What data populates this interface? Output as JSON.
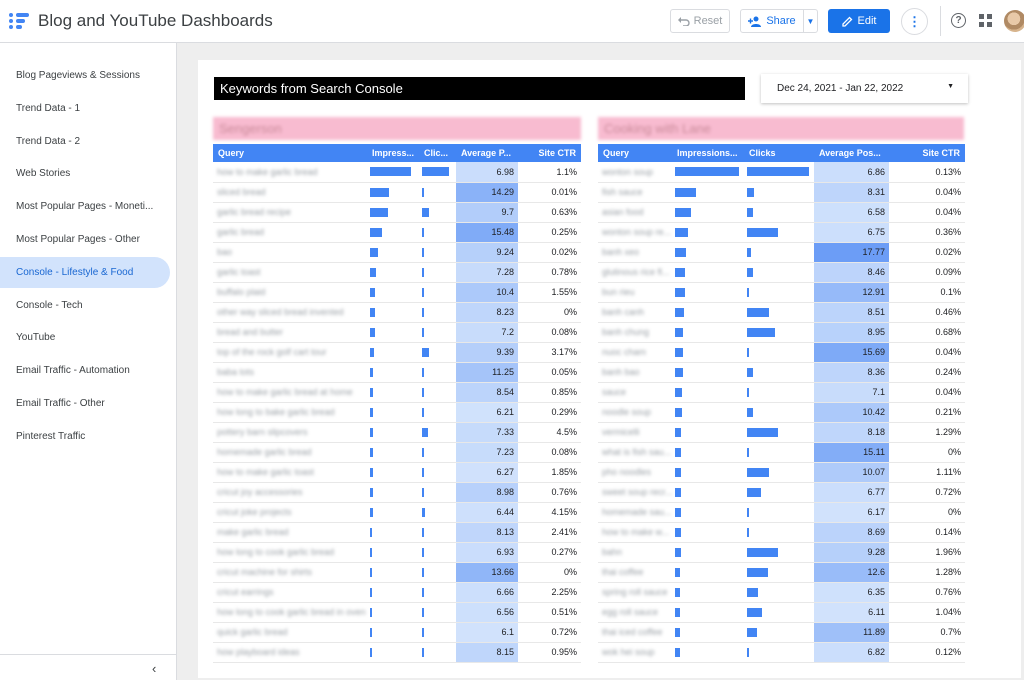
{
  "app": {
    "title": "Blog and YouTube Dashboards"
  },
  "toolbar": {
    "reset_label": "Reset",
    "share_label": "Share",
    "edit_label": "Edit"
  },
  "sidebar": {
    "items": [
      {
        "label": "Blog Pageviews & Sessions",
        "active": false
      },
      {
        "label": "Trend Data - 1",
        "active": false
      },
      {
        "label": "Trend Data - 2",
        "active": false
      },
      {
        "label": "Web Stories",
        "active": false
      },
      {
        "label": "Most Popular Pages - Moneti...",
        "active": false
      },
      {
        "label": "Most Popular Pages - Other",
        "active": false
      },
      {
        "label": "Console - Lifestyle & Food",
        "active": true
      },
      {
        "label": "Console - Tech",
        "active": false
      },
      {
        "label": "YouTube",
        "active": false
      },
      {
        "label": "Email Traffic - Automation",
        "active": false
      },
      {
        "label": "Email Traffic - Other",
        "active": false
      },
      {
        "label": "Pinterest Traffic",
        "active": false
      }
    ]
  },
  "report": {
    "title": "Keywords from Search Console",
    "date_range": "Dec 24, 2021 - Jan 22, 2022"
  },
  "colors": {
    "accent": "#1a73e8",
    "header_blue": "#4285f4",
    "site_title_pink": "#f8bbd0"
  },
  "tables": [
    {
      "site_title": "Sengerson",
      "columns": [
        "Query",
        "Impress...",
        "Clic...",
        "Average P...",
        "Site CTR"
      ],
      "rows": [
        {
          "query": "how to make garlic bread",
          "impressions": 0.97,
          "clicks": 1.0,
          "avg_pos": "6.98",
          "ctr": "1.1%"
        },
        {
          "query": "sliced bread",
          "impressions": 0.45,
          "clicks": 0.03,
          "avg_pos": "14.29",
          "ctr": "0.01%"
        },
        {
          "query": "garlic bread recipe",
          "impressions": 0.42,
          "clicks": 0.25,
          "avg_pos": "9.7",
          "ctr": "0.63%"
        },
        {
          "query": "garlic bread",
          "impressions": 0.28,
          "clicks": 0.03,
          "avg_pos": "15.48",
          "ctr": "0.25%"
        },
        {
          "query": "bao",
          "impressions": 0.19,
          "clicks": 0.02,
          "avg_pos": "9.24",
          "ctr": "0.02%"
        },
        {
          "query": "garlic toast",
          "impressions": 0.14,
          "clicks": 0.05,
          "avg_pos": "7.28",
          "ctr": "0.78%"
        },
        {
          "query": "buffalo plaid",
          "impressions": 0.13,
          "clicks": 0.09,
          "avg_pos": "10.4",
          "ctr": "1.55%"
        },
        {
          "query": "other way sliced bread invented",
          "impressions": 0.12,
          "clicks": 0.0,
          "avg_pos": "8.23",
          "ctr": "0%"
        },
        {
          "query": "bread and butter",
          "impressions": 0.11,
          "clicks": 0.03,
          "avg_pos": "7.2",
          "ctr": "0.08%"
        },
        {
          "query": "top of the rock golf cart tour",
          "impressions": 0.09,
          "clicks": 0.27,
          "avg_pos": "9.39",
          "ctr": "3.17%"
        },
        {
          "query": "baba tots",
          "impressions": 0.08,
          "clicks": 0.02,
          "avg_pos": "11.25",
          "ctr": "0.05%"
        },
        {
          "query": "how to make garlic bread at home",
          "impressions": 0.08,
          "clicks": 0.03,
          "avg_pos": "8.54",
          "ctr": "0.85%"
        },
        {
          "query": "how long to bake garlic bread",
          "impressions": 0.07,
          "clicks": 0.02,
          "avg_pos": "6.21",
          "ctr": "0.29%"
        },
        {
          "query": "pottery barn slipcovers",
          "impressions": 0.07,
          "clicks": 0.22,
          "avg_pos": "7.33",
          "ctr": "4.5%"
        },
        {
          "query": "homemade garlic bread",
          "impressions": 0.07,
          "clicks": 0.02,
          "avg_pos": "7.23",
          "ctr": "0.08%"
        },
        {
          "query": "how to make garlic toast",
          "impressions": 0.06,
          "clicks": 0.04,
          "avg_pos": "6.27",
          "ctr": "1.85%"
        },
        {
          "query": "cricut joy accessories",
          "impressions": 0.06,
          "clicks": 0.03,
          "avg_pos": "8.98",
          "ctr": "0.76%"
        },
        {
          "query": "cricut joke projects",
          "impressions": 0.06,
          "clicks": 0.12,
          "avg_pos": "6.44",
          "ctr": "4.15%"
        },
        {
          "query": "make garlic bread",
          "impressions": 0.05,
          "clicks": 0.05,
          "avg_pos": "8.13",
          "ctr": "2.41%"
        },
        {
          "query": "how long to cook garlic bread",
          "impressions": 0.05,
          "clicks": 0.02,
          "avg_pos": "6.93",
          "ctr": "0.27%"
        },
        {
          "query": "cricut machine for shirts",
          "impressions": 0.05,
          "clicks": 0.0,
          "avg_pos": "13.66",
          "ctr": "0%"
        },
        {
          "query": "cricut earrings",
          "impressions": 0.05,
          "clicks": 0.06,
          "avg_pos": "6.66",
          "ctr": "2.25%"
        },
        {
          "query": "how long to cook garlic bread in oven",
          "impressions": 0.05,
          "clicks": 0.03,
          "avg_pos": "6.56",
          "ctr": "0.51%"
        },
        {
          "query": "quick garlic bread",
          "impressions": 0.05,
          "clicks": 0.02,
          "avg_pos": "6.1",
          "ctr": "0.72%"
        },
        {
          "query": "how playboard ideas",
          "impressions": 0.05,
          "clicks": 0.02,
          "avg_pos": "8.15",
          "ctr": "0.95%"
        }
      ]
    },
    {
      "site_title": "Cooking with Lane",
      "columns": [
        "Query",
        "Impressions...",
        "Clicks",
        "Average Pos...",
        "Site CTR"
      ],
      "rows": [
        {
          "query": "wonton soup",
          "impressions": 1.0,
          "clicks": 1.0,
          "avg_pos": "6.86",
          "ctr": "0.13%"
        },
        {
          "query": "fish sauce",
          "impressions": 0.33,
          "clicks": 0.11,
          "avg_pos": "8.31",
          "ctr": "0.04%"
        },
        {
          "query": "asian food",
          "impressions": 0.25,
          "clicks": 0.09,
          "avg_pos": "6.58",
          "ctr": "0.04%"
        },
        {
          "query": "wonton soup re...",
          "impressions": 0.2,
          "clicks": 0.5,
          "avg_pos": "6.75",
          "ctr": "0.36%"
        },
        {
          "query": "banh xeo",
          "impressions": 0.17,
          "clicks": 0.06,
          "avg_pos": "17.77",
          "ctr": "0.02%"
        },
        {
          "query": "glutinous rice fl...",
          "impressions": 0.16,
          "clicks": 0.1,
          "avg_pos": "8.46",
          "ctr": "0.09%"
        },
        {
          "query": "bun rieu",
          "impressions": 0.15,
          "clicks": 0.03,
          "avg_pos": "12.91",
          "ctr": "0.1%"
        },
        {
          "query": "banh canh",
          "impressions": 0.14,
          "clicks": 0.35,
          "avg_pos": "8.51",
          "ctr": "0.46%"
        },
        {
          "query": "banh chung",
          "impressions": 0.13,
          "clicks": 0.45,
          "avg_pos": "8.95",
          "ctr": "0.68%"
        },
        {
          "query": "nuoc cham",
          "impressions": 0.12,
          "clicks": 0.02,
          "avg_pos": "15.69",
          "ctr": "0.04%"
        },
        {
          "query": "banh bao",
          "impressions": 0.12,
          "clicks": 0.1,
          "avg_pos": "8.36",
          "ctr": "0.24%"
        },
        {
          "query": "sauce",
          "impressions": 0.11,
          "clicks": 0.02,
          "avg_pos": "7.1",
          "ctr": "0.04%"
        },
        {
          "query": "noodle soup",
          "impressions": 0.11,
          "clicks": 0.1,
          "avg_pos": "10.42",
          "ctr": "0.21%"
        },
        {
          "query": "vermicelli",
          "impressions": 0.1,
          "clicks": 0.5,
          "avg_pos": "8.18",
          "ctr": "1.29%"
        },
        {
          "query": "what is fish sau...",
          "impressions": 0.1,
          "clicks": 0.0,
          "avg_pos": "15.11",
          "ctr": "0%"
        },
        {
          "query": "pho noodles",
          "impressions": 0.1,
          "clicks": 0.36,
          "avg_pos": "10.07",
          "ctr": "1.11%"
        },
        {
          "query": "sweet soup recr...",
          "impressions": 0.09,
          "clicks": 0.22,
          "avg_pos": "6.77",
          "ctr": "0.72%"
        },
        {
          "query": "homemade sau...",
          "impressions": 0.09,
          "clicks": 0.0,
          "avg_pos": "6.17",
          "ctr": "0%"
        },
        {
          "query": "how to make w...",
          "impressions": 0.09,
          "clicks": 0.02,
          "avg_pos": "8.69",
          "ctr": "0.14%"
        },
        {
          "query": "bahn",
          "impressions": 0.09,
          "clicks": 0.5,
          "avg_pos": "9.28",
          "ctr": "1.96%"
        },
        {
          "query": "thai coffee",
          "impressions": 0.08,
          "clicks": 0.34,
          "avg_pos": "12.6",
          "ctr": "1.28%"
        },
        {
          "query": "spring roll sauce",
          "impressions": 0.08,
          "clicks": 0.18,
          "avg_pos": "6.35",
          "ctr": "0.76%"
        },
        {
          "query": "egg roll sauce",
          "impressions": 0.08,
          "clicks": 0.24,
          "avg_pos": "6.11",
          "ctr": "1.04%"
        },
        {
          "query": "thai iced coffee",
          "impressions": 0.08,
          "clicks": 0.16,
          "avg_pos": "11.89",
          "ctr": "0.7%"
        },
        {
          "query": "wok hei soup",
          "impressions": 0.08,
          "clicks": 0.02,
          "avg_pos": "6.82",
          "ctr": "0.12%"
        }
      ]
    }
  ]
}
